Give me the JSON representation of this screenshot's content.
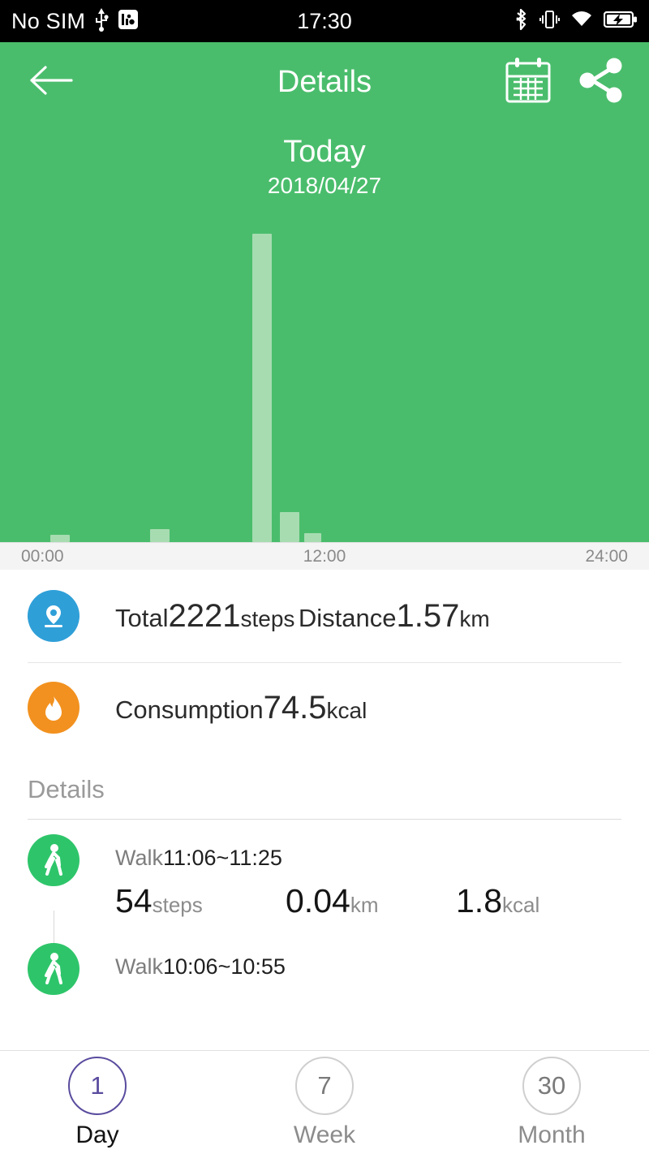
{
  "statusbar": {
    "carrier": "No SIM",
    "clock": "17:30",
    "icons": [
      "usb-icon",
      "adb-icon",
      "bluetooth-icon",
      "vibrate-icon",
      "wifi-icon",
      "battery-charging-icon"
    ]
  },
  "appbar": {
    "back_icon": "back-arrow-icon",
    "title": "Details",
    "calendar_icon": "calendar-icon",
    "share_icon": "share-icon"
  },
  "day": {
    "label": "Today",
    "date": "2018/04/27"
  },
  "colors": {
    "green": "#4abd6c",
    "bar": "#a7dcb1",
    "pin_blue": "#2f9fd8",
    "flame_orange": "#f2911f",
    "walk_green": "#2ec56a",
    "accent_purple": "#5a4b9e"
  },
  "chart_data": {
    "type": "bar",
    "title": "Daily step activity",
    "xlabel": "",
    "ylabel": "steps",
    "grid": false,
    "legend": false,
    "xticks": [
      "00:00",
      "12:00",
      "24:00"
    ],
    "xlim": [
      0,
      24
    ],
    "ylim": [
      0,
      1400
    ],
    "x": [
      1.9,
      5.6,
      9.4,
      10.4,
      11.3
    ],
    "values": [
      30,
      55,
      1330,
      130,
      40
    ],
    "bars": [
      {
        "x_pct": 7.8,
        "width_pct": 3.0,
        "height_pct": 2.3,
        "time": "01:52",
        "steps": 30
      },
      {
        "x_pct": 23.1,
        "width_pct": 3.0,
        "height_pct": 4.0,
        "time": "05:32",
        "steps": 55
      },
      {
        "x_pct": 38.9,
        "width_pct": 3.0,
        "height_pct": 95.0,
        "time": "09:20",
        "steps": 1330
      },
      {
        "x_pct": 43.1,
        "width_pct": 3.0,
        "height_pct": 9.3,
        "time": "10:20",
        "steps": 130
      },
      {
        "x_pct": 46.9,
        "width_pct": 2.6,
        "height_pct": 2.8,
        "time": "11:15",
        "steps": 40
      }
    ]
  },
  "summary": {
    "steps": {
      "icon": "location-pin-icon",
      "label": "Total",
      "value": "2221",
      "unit": "steps",
      "label2": "Distance",
      "value2": "1.57",
      "unit2": "km"
    },
    "calories": {
      "icon": "flame-icon",
      "label": "Consumption",
      "value": "74.5",
      "unit": "kcal"
    }
  },
  "details": {
    "header": "Details",
    "entries": [
      {
        "icon": "walk-icon",
        "type": "Walk",
        "time_range": "11:06~11:25",
        "steps_value": "54",
        "steps_unit": "steps",
        "distance_value": "0.04",
        "distance_unit": "km",
        "calories_value": "1.8",
        "calories_unit": "kcal"
      },
      {
        "icon": "walk-icon",
        "type": "Walk",
        "time_range": "10:06~10:55",
        "steps_value": "",
        "steps_unit": "",
        "distance_value": "",
        "distance_unit": "",
        "calories_value": "",
        "calories_unit": ""
      }
    ]
  },
  "tabs": [
    {
      "number": "1",
      "label": "Day",
      "active": true
    },
    {
      "number": "7",
      "label": "Week",
      "active": false
    },
    {
      "number": "30",
      "label": "Month",
      "active": false
    }
  ]
}
